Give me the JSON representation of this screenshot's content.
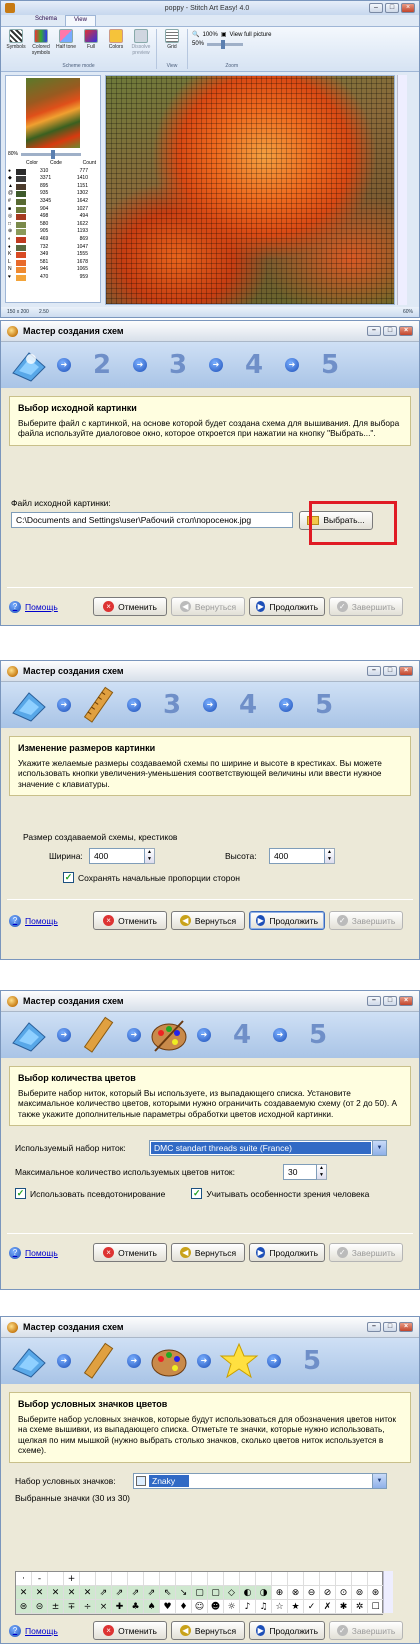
{
  "app": {
    "window_title": "poppy - Stitch Art Easy! 4.0",
    "tabs": [
      "Schema",
      "View"
    ],
    "active_tab": "View",
    "ribbon": {
      "scheme_mode_buttons": [
        "Symbols",
        "Colored symbols",
        "Half tone",
        "Full",
        "Colors",
        "Dissolve preview"
      ],
      "scheme_mode_group": "Scheme mode",
      "grid_button": "Grid",
      "view_group": "View",
      "zoom_100": "100%",
      "view_full_picture": "View full picture",
      "zoom_value": "50%",
      "zoom_group": "Zoom"
    },
    "thumb_zoom": "80%",
    "color_table": {
      "headers": [
        "Color",
        "Code",
        "Count"
      ],
      "rows": [
        {
          "sym": "●",
          "color": "#2b2b2b",
          "code": "310",
          "count": "777"
        },
        {
          "sym": "◆",
          "color": "#3b3b3b",
          "code": "3371",
          "count": "1410"
        },
        {
          "sym": "▲",
          "color": "#4b3b2b",
          "code": "895",
          "count": "1151"
        },
        {
          "sym": "@",
          "color": "#3e5a2a",
          "code": "935",
          "count": "1302"
        },
        {
          "sym": "#",
          "color": "#586a32",
          "code": "3345",
          "count": "1642"
        },
        {
          "sym": "■",
          "color": "#6b7a3a",
          "code": "904",
          "count": "1027"
        },
        {
          "sym": "◎",
          "color": "#a63a20",
          "code": "498",
          "count": "494"
        },
        {
          "sym": "□",
          "color": "#7a8a4a",
          "code": "580",
          "count": "1622"
        },
        {
          "sym": "⊕",
          "color": "#8a9a5a",
          "code": "905",
          "count": "1193"
        },
        {
          "sym": "◐",
          "color": "#c03a20",
          "code": "469",
          "count": "869"
        },
        {
          "sym": "♦",
          "color": "#5a6a40",
          "code": "732",
          "count": "1047"
        },
        {
          "sym": "K",
          "color": "#d84a24",
          "code": "349",
          "count": "1555"
        },
        {
          "sym": "L",
          "color": "#e86a2a",
          "code": "581",
          "count": "1678"
        },
        {
          "sym": "N",
          "color": "#ef8a30",
          "code": "946",
          "count": "1065"
        },
        {
          "sym": "♥",
          "color": "#f3a43a",
          "code": "470",
          "count": "959"
        }
      ]
    },
    "status": {
      "size": "150 x 200",
      "value": "2.50",
      "zoom": "60%"
    }
  },
  "wizard_title": "Мастер создания схем",
  "step_numbers": [
    "2",
    "3",
    "4",
    "5"
  ],
  "buttons": {
    "help": "Помощь",
    "cancel": "Отменить",
    "back": "Вернуться",
    "next": "Продолжить",
    "finish": "Завершить"
  },
  "step1": {
    "heading": "Выбор исходной картинки",
    "text": "Выберите файл с картинкой, на основе которой будет создана схема для вышивания. Для выбора файла используйте диалоговое окно, которое откроется при нажатии на кнопку \"Выбрать...\".",
    "file_label": "Файл исходной картинки:",
    "file_path": "C:\\Documents and Settings\\user\\Рабочий стол\\поросенок.jpg",
    "choose_button": "Выбрать..."
  },
  "step2": {
    "heading": "Изменение размеров картинки",
    "text": "Укажите желаемые размеры создаваемой схемы по ширине и высоте в крестиках. Вы можете использовать кнопки увеличения-уменьшения соответствующей величины или ввести нужное значение с клавиатуры.",
    "group_label": "Размер создаваемой схемы, крестиков",
    "width_label": "Ширина:",
    "width_value": "400",
    "height_label": "Высота:",
    "height_value": "400",
    "keep_ratio": "Сохранять начальные пропорции сторон"
  },
  "step3": {
    "heading": "Выбор количества цветов",
    "text": "Выберите набор ниток, который Вы используете, из выпадающего списка. Установите максимальное количество цветов, которыми нужно ограничить создаваемую схему (от 2 до 50). А также укажите дополнительные параметры обработки цветов исходной картинки.",
    "thread_label": "Используемый набор ниток:",
    "thread_value": "DMC standart threads suite (France)",
    "max_colors_label": "Максимальное количество используемых цветов ниток:",
    "max_colors_value": "30",
    "pseudotone": "Использовать псевдотонирование",
    "vision": "Учитывать особенности зрения человека"
  },
  "step4": {
    "heading": "Выбор условных значков цветов",
    "text": "Выберите набор условных значков, которые будут использоваться для обозначения цветов ниток на схеме вышивки, из выпадающего списка. Отметьте те значки, которые нужно использовать, щелкая по ним мышкой (нужно выбрать столько значков, сколько цветов ниток используется в схеме).",
    "symbol_set_label": "Набор условных значков:",
    "symbol_set_value": "Znaky",
    "selected_label": "Выбранные значки (30 из 30)",
    "symbols": [
      "·",
      "-",
      "",
      "+",
      "",
      "",
      "",
      "",
      "",
      "",
      "",
      "",
      "",
      "",
      "",
      "",
      "",
      "",
      "",
      "",
      "",
      "",
      "",
      "✕",
      "✕",
      "✕",
      "✕",
      "✕",
      "⇗",
      "⇗",
      "⇗",
      "⇗",
      "⇖",
      "↘",
      "▢",
      "▢",
      "◇",
      "◐",
      "◑",
      "⊕",
      "⊗",
      "⊖",
      "⊘",
      "⊙",
      "⊚",
      "⊛",
      "⊜",
      "⊝",
      "±",
      "∓",
      "÷",
      "×",
      "✚",
      "♣",
      "♠",
      "♥",
      "♦",
      "☺",
      "☻",
      "☼",
      "♪",
      "♫",
      "☆",
      "★",
      "✓",
      "✗",
      "✱",
      "✲",
      "☐",
      "☑",
      "⌘",
      "⌂",
      "⊞",
      "⊟",
      "⊠",
      "⊡",
      "♂",
      "♀",
      "☘",
      "⚑",
      "⚐",
      "⚙",
      "⚬",
      "⚭",
      "◈",
      "◉",
      "▣",
      "▤",
      "▥",
      "▦",
      "▧",
      "▨",
      "▩",
      "⬒",
      "⬓",
      "⬔",
      "⬕",
      "⊿",
      "△",
      "▽",
      "◁",
      "▷",
      "⋈",
      "⋉",
      "⋊",
      "⋋",
      "⋌",
      "⊳",
      "⊲",
      "∆",
      "∇",
      "∞",
      "∑",
      "∏",
      "∫",
      "∮",
      "⊥",
      "∥",
      "∠",
      "∡",
      "∢",
      "⌐",
      "¬",
      "¤",
      "§",
      "¶",
      "†",
      "‡",
      "•",
      "◊",
      "○",
      "●",
      "◦",
      "✦",
      "✧",
      "✩",
      "✪",
      "✫",
      "✬",
      "✭",
      "✮",
      "✯",
      "✰",
      "❖",
      "❂",
      "❍",
      "❏",
      "❐",
      "❑",
      "❒"
    ],
    "selected_indices": [
      23,
      24,
      25,
      26,
      27,
      28,
      29,
      30,
      31,
      32,
      33,
      34,
      35,
      36,
      37,
      38,
      46,
      47,
      48,
      49,
      50,
      51,
      52,
      53,
      54,
      69,
      70,
      71,
      72,
      73
    ]
  }
}
